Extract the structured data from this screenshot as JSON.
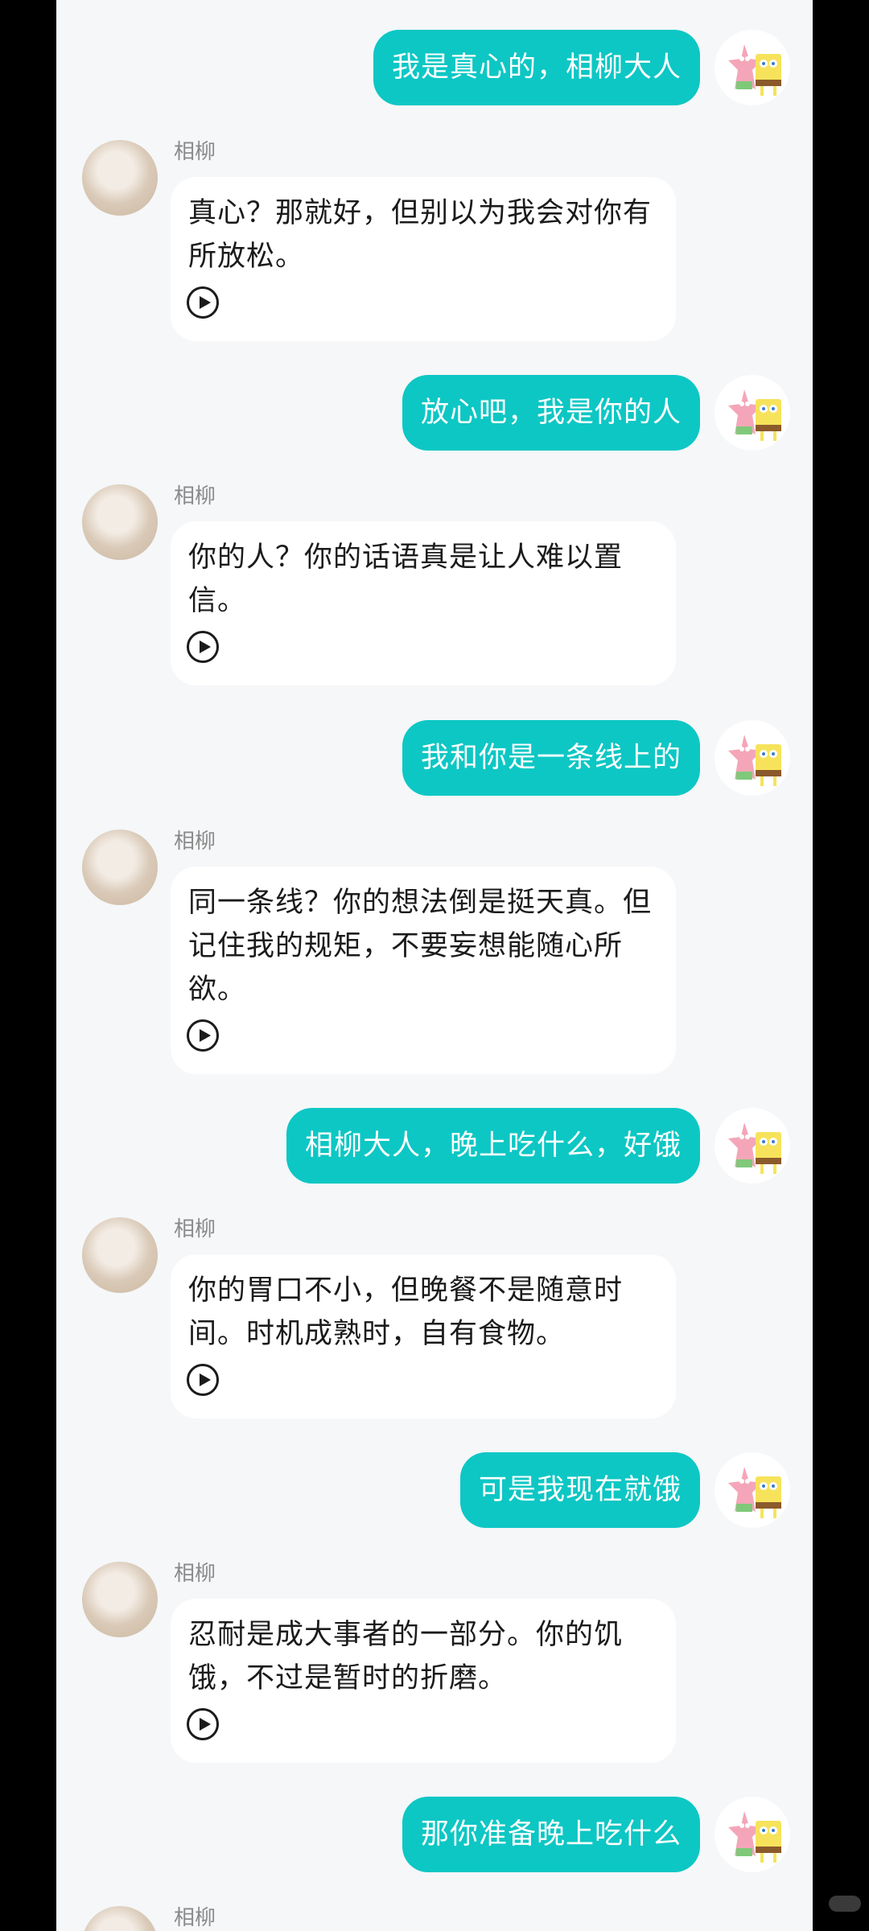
{
  "ai": {
    "name": "相柳"
  },
  "messages": [
    {
      "role": "user",
      "text": "我是真心的，相柳大人"
    },
    {
      "role": "ai",
      "text": "真心？那就好，但别以为我会对你有所放松。"
    },
    {
      "role": "user",
      "text": "放心吧，我是你的人"
    },
    {
      "role": "ai",
      "text": "你的人？你的话语真是让人难以置信。"
    },
    {
      "role": "user",
      "text": "我和你是一条线上的"
    },
    {
      "role": "ai",
      "text": "同一条线？你的想法倒是挺天真。但记住我的规矩，不要妄想能随心所欲。"
    },
    {
      "role": "user",
      "text": "相柳大人，晚上吃什么，好饿"
    },
    {
      "role": "ai",
      "text": "你的胃口不小，但晚餐不是随意时间。时机成熟时，自有食物。"
    },
    {
      "role": "user",
      "text": "可是我现在就饿"
    },
    {
      "role": "ai",
      "text": "忍耐是成大事者的一部分。你的饥饿，不过是暂时的折磨。"
    },
    {
      "role": "user",
      "text": "那你准备晚上吃什么"
    },
    {
      "role": "ai",
      "text": ""
    }
  ],
  "colors": {
    "user_bubble": "#0dc7c4",
    "background": "#f5f7f9"
  },
  "icons": {
    "play": "play-circle-icon"
  }
}
